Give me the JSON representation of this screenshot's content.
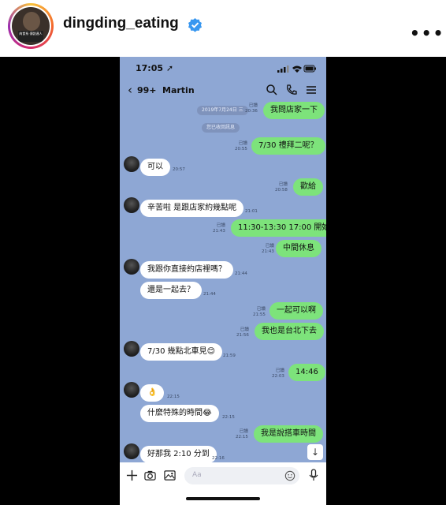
{
  "post_header": {
    "username": "dingding_eating",
    "verified": true,
    "more_label": "•••",
    "avatar_icon": "profile-avatar",
    "avatar_text": "肉食系 傳說達人"
  },
  "phone": {
    "status_time": "17:05 ➚",
    "topbar": {
      "back_label": "‹",
      "unread": "99+",
      "contact": "Martin",
      "icons": [
        "search-icon",
        "phone-icon",
        "menu-icon"
      ]
    },
    "date_pill": "2019年7月24日 三",
    "unsent_pill": "您已收回訊息",
    "messages": [
      {
        "side": "me",
        "text": "我問店家一下",
        "read": "已讀",
        "time": "20:36"
      },
      {
        "side": "me",
        "text": "7/30 禮拜二呢？",
        "read": "已讀",
        "time": "20:55"
      },
      {
        "side": "them",
        "text": "可以",
        "time": "20:57"
      },
      {
        "side": "me",
        "text": "歡給",
        "read": "已讀",
        "time": "20:58"
      },
      {
        "side": "them",
        "text": "辛苦啦 是跟店家約幾點呢",
        "time": "21:01"
      },
      {
        "side": "me",
        "text": "11:30-13:30 17:00 開始",
        "read": "已讀",
        "time": "21:43"
      },
      {
        "side": "me",
        "text": "中間休息",
        "read": "已讀",
        "time": "21:43"
      },
      {
        "side": "them",
        "text": "我跟你直接約店裡嗎？",
        "time": "21:44"
      },
      {
        "side": "them",
        "text": "還是一起去？",
        "time": "21:44"
      },
      {
        "side": "me",
        "text": "一起可以啊",
        "read": "已讀",
        "time": "21:55"
      },
      {
        "side": "me",
        "text": "我也是台北下去",
        "read": "已讀",
        "time": "21:56"
      },
      {
        "side": "them",
        "text": "7/30 幾點北車見😊",
        "time": "21:59"
      },
      {
        "side": "me",
        "text": "14:46",
        "read": "已讀",
        "time": "22:03"
      },
      {
        "side": "them",
        "text": "👌",
        "time": "22:15"
      },
      {
        "side": "them",
        "text": "什麼特殊的時間😂",
        "time": "22:15"
      },
      {
        "side": "me",
        "text": "我是說搭車時間",
        "read": "已讀",
        "time": "22:15"
      },
      {
        "side": "them",
        "text": "好那我 2:10 分到",
        "time": "22:16"
      }
    ],
    "input": {
      "placeholder": "Aa",
      "icons": [
        "plus-icon",
        "camera-icon",
        "image-icon",
        "emoji-icon",
        "mic-icon"
      ]
    },
    "scroll_down_label": "↓"
  },
  "colors": {
    "chat_bg": "#8ea7d4",
    "my_bubble": "#7de37b",
    "their_bubble": "#ffffff",
    "verified": "#3897f0"
  }
}
